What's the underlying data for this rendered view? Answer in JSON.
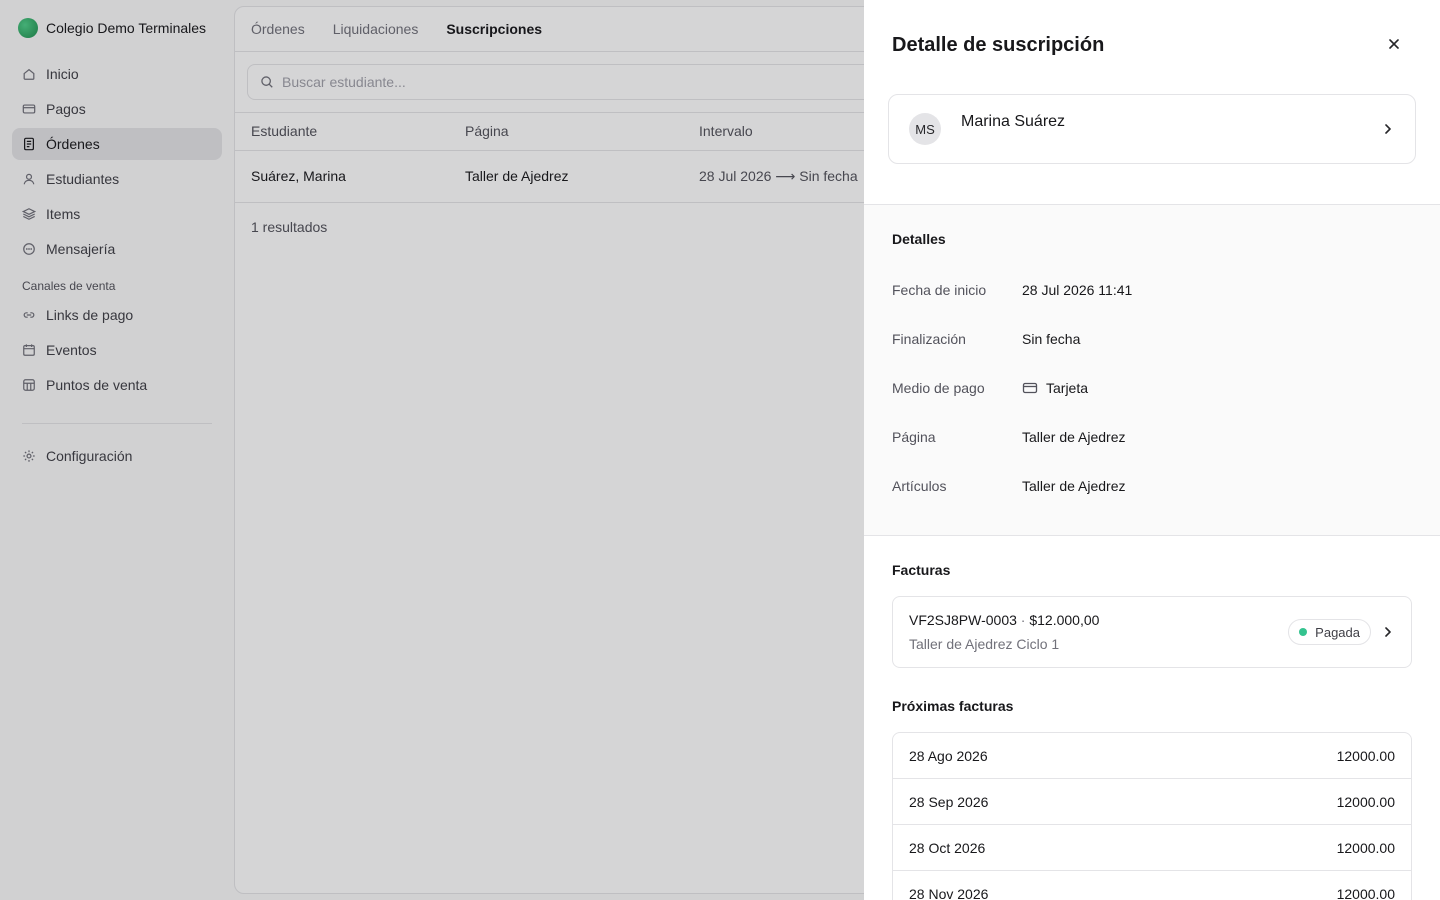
{
  "brand": {
    "name": "Colegio Demo Terminales"
  },
  "sidebar": {
    "items": [
      {
        "label": "Inicio",
        "icon": "home-icon"
      },
      {
        "label": "Pagos",
        "icon": "credit-card-icon"
      },
      {
        "label": "Órdenes",
        "icon": "receipt-icon",
        "active": true
      },
      {
        "label": "Estudiantes",
        "icon": "user-icon"
      },
      {
        "label": "Items",
        "icon": "layers-icon"
      },
      {
        "label": "Mensajería",
        "icon": "message-icon"
      }
    ],
    "channels_label": "Canales de venta",
    "channels": [
      {
        "label": "Links de pago",
        "icon": "link-icon"
      },
      {
        "label": "Eventos",
        "icon": "calendar-icon"
      },
      {
        "label": "Puntos de venta",
        "icon": "store-icon"
      }
    ],
    "settings": {
      "label": "Configuración",
      "icon": "gear-icon"
    }
  },
  "main": {
    "tabs": [
      {
        "label": "Órdenes"
      },
      {
        "label": "Liquidaciones"
      },
      {
        "label": "Suscripciones",
        "active": true
      }
    ],
    "search": {
      "placeholder": "Buscar estudiante..."
    },
    "table": {
      "headers": [
        "Estudiante",
        "Página",
        "Intervalo"
      ],
      "rows": [
        {
          "student": "Suárez, Marina",
          "page": "Taller de Ajedrez",
          "interval": "28 Jul 2026 ⟶ Sin fecha"
        }
      ]
    },
    "results": "1 resultados"
  },
  "drawer": {
    "title": "Detalle de suscripción",
    "customer": {
      "initials": "MS",
      "name": "Marina Suárez"
    },
    "details": {
      "title": "Detalles",
      "rows": [
        {
          "label": "Fecha de inicio",
          "value": "28 Jul 2026 11:41"
        },
        {
          "label": "Finalización",
          "value": "Sin fecha"
        },
        {
          "label": "Medio de pago",
          "value": "Tarjeta",
          "icon": "credit-card-icon"
        },
        {
          "label": "Página",
          "value": "Taller de Ajedrez"
        },
        {
          "label": "Artículos",
          "value": "Taller de Ajedrez"
        }
      ]
    },
    "invoices": {
      "title": "Facturas",
      "items": [
        {
          "number": "VF2SJ8PW-0003",
          "amount": "$12.000,00",
          "description": "Taller de Ajedrez Ciclo 1",
          "status": "Pagada",
          "status_color": "#34c38f"
        }
      ]
    },
    "upcoming": {
      "title": "Próximas facturas",
      "rows": [
        {
          "date": "28 Ago 2026",
          "amount": "12000.00"
        },
        {
          "date": "28 Sep 2026",
          "amount": "12000.00"
        },
        {
          "date": "28 Oct 2026",
          "amount": "12000.00"
        },
        {
          "date": "28 Nov 2026",
          "amount": "12000.00"
        }
      ]
    }
  }
}
